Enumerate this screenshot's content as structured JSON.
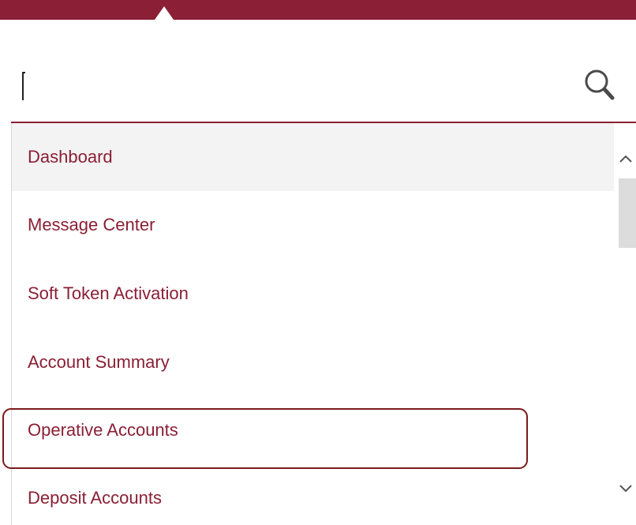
{
  "search": {
    "value": "",
    "placeholder": ""
  },
  "menu": {
    "items": [
      {
        "label": "Dashboard"
      },
      {
        "label": "Message Center"
      },
      {
        "label": "Soft Token Activation"
      },
      {
        "label": "Account Summary"
      },
      {
        "label": "Operative Accounts"
      },
      {
        "label": "Deposit Accounts"
      }
    ]
  },
  "colors": {
    "brand": "#8a1f35",
    "active_bg": "#f3f3f3",
    "highlight_border": "#7a1a1a"
  },
  "icons": {
    "search": "search-icon",
    "scroll_up": "chevron-up-icon",
    "scroll_down": "chevron-down-icon"
  }
}
